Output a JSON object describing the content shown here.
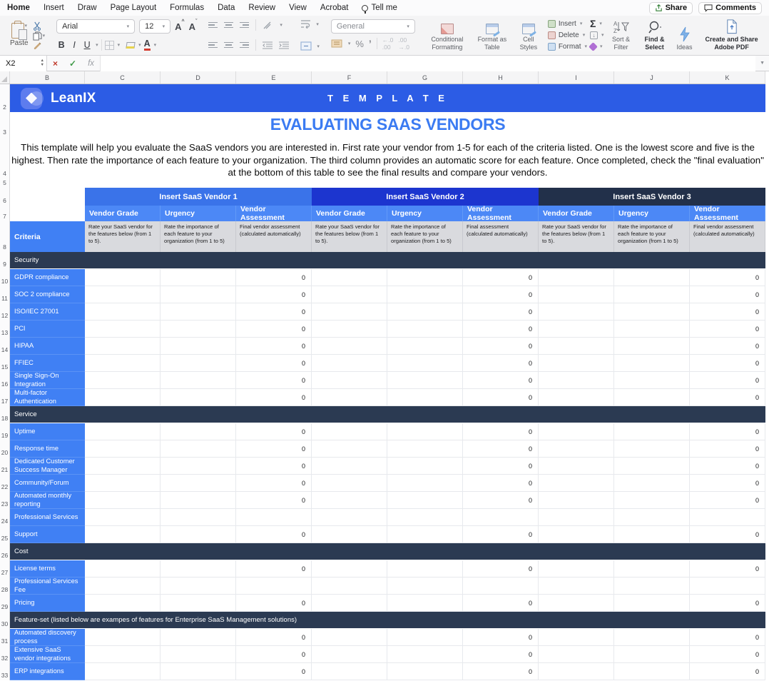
{
  "ribbon": {
    "tabs": [
      {
        "label": "Home",
        "active": true
      },
      {
        "label": "Insert",
        "active": false
      },
      {
        "label": "Draw",
        "active": false
      },
      {
        "label": "Page Layout",
        "active": false
      },
      {
        "label": "Formulas",
        "active": false
      },
      {
        "label": "Data",
        "active": false
      },
      {
        "label": "Review",
        "active": false
      },
      {
        "label": "View",
        "active": false
      },
      {
        "label": "Acrobat",
        "active": false
      },
      {
        "label": "Tell me",
        "active": false
      }
    ],
    "share_label": "Share",
    "comments_label": "Comments",
    "clipboard": {
      "paste": "Paste"
    },
    "font": {
      "name": "Arial",
      "size": "12",
      "bold": "B",
      "italic": "I",
      "underline": "U",
      "grow": "A",
      "shrink": "A",
      "color_letter": "A"
    },
    "number": {
      "format": "General",
      "percent": "%",
      "comma": "’"
    },
    "styles": {
      "conditional": "Conditional Formatting",
      "as_table": "Format as Table",
      "cell_styles": "Cell Styles"
    },
    "cells": {
      "insert": "Insert",
      "delete": "Delete",
      "format": "Format"
    },
    "editing": {
      "sort": "Sort & Filter",
      "find": "Find & Select"
    },
    "ideas_label": "Ideas",
    "adobe_label": "Create and Share Adobe PDF"
  },
  "formula_bar": {
    "name_box": "X2",
    "fx": "fx"
  },
  "sheet": {
    "columns": [
      "B",
      "C",
      "D",
      "E",
      "F",
      "G",
      "H",
      "I",
      "J",
      "K"
    ],
    "gutter_prefix": [
      "2",
      "3",
      "4",
      "5",
      "6",
      "7",
      "8"
    ],
    "banner": {
      "brand": "LeanIX",
      "tag": "T E M P L A T E",
      "color": "#2c5ce5"
    },
    "title": "EVALUATING SAAS VENDORS",
    "title_color": "#3b7bf2",
    "intro": "This template will help you evaluate the SaaS vendors you are interested in. First rate your vendor from 1-5 for each of the criteria listed. One is the lowest score and five is the highest. Then rate the importance of each feature to your organization. The third column provides an automatic score for each feature. Once completed, check the \"final evaluation\" at the bottom of this table to see the final results and compare your vendors.",
    "vendors": [
      {
        "label": "Insert SaaS Vendor 1",
        "color": "#3a73e9"
      },
      {
        "label": "Insert SaaS Vendor 2",
        "color": "#1c35cf"
      },
      {
        "label": "Insert SaaS Vendor 3",
        "color": "#22304a"
      }
    ],
    "subheaders": [
      "Vendor Grade",
      "Urgency",
      "Vendor Assessment"
    ],
    "criteria_header": "Criteria",
    "descriptions": [
      "Rate your SaaS vendor for the features below (from 1 to 5).",
      "Rate the importance of each feature to your organization (from 1 to 5)",
      "Final vendor assessment (calculated automatically)",
      "Rate your SaaS vendor for the features below (from 1 to 5).",
      "Rate the importance of each feature to your organization (from 1 to 5)",
      "Final assessment (calculated automatically)",
      "Rate your SaaS vendor for the features below (from 1 to 5).",
      "Rate the importance of each feature to your organization (from 1 to 5)",
      "Final vendor assessment (calculated automatically)"
    ],
    "zero_value": "0",
    "rows": [
      {
        "n": "9",
        "kind": "section",
        "label": "Security"
      },
      {
        "n": "10",
        "kind": "item",
        "label": "GDPR compliance",
        "zero": true
      },
      {
        "n": "11",
        "kind": "item",
        "label": "SOC 2 compliance",
        "zero": true
      },
      {
        "n": "12",
        "kind": "item",
        "label": "ISO/IEC 27001",
        "zero": true
      },
      {
        "n": "13",
        "kind": "item",
        "label": "PCI",
        "zero": true
      },
      {
        "n": "14",
        "kind": "item",
        "label": "HIPAA",
        "zero": true
      },
      {
        "n": "15",
        "kind": "item",
        "label": "FFIEC",
        "zero": true
      },
      {
        "n": "16",
        "kind": "item",
        "label": "Single Sign-On Integration",
        "zero": true
      },
      {
        "n": "17",
        "kind": "item",
        "label": "Multi-factor Authentication",
        "zero": true
      },
      {
        "n": "18",
        "kind": "section",
        "label": "Service"
      },
      {
        "n": "19",
        "kind": "item",
        "label": "Uptime",
        "zero": true
      },
      {
        "n": "20",
        "kind": "item",
        "label": "Response time",
        "zero": true
      },
      {
        "n": "21",
        "kind": "item",
        "label": "Dedicated Customer Success Manager",
        "zero": true
      },
      {
        "n": "22",
        "kind": "item",
        "label": "Community/Forum",
        "zero": true
      },
      {
        "n": "23",
        "kind": "item",
        "label": "Automated monthly reporting",
        "zero": true
      },
      {
        "n": "24",
        "kind": "item",
        "label": "Professional Services",
        "zero": false
      },
      {
        "n": "25",
        "kind": "item",
        "label": "Support",
        "zero": true
      },
      {
        "n": "26",
        "kind": "section",
        "label": "Cost"
      },
      {
        "n": "27",
        "kind": "item",
        "label": "License terms",
        "zero": true
      },
      {
        "n": "28",
        "kind": "item",
        "label": "Professional Services Fee",
        "zero": false
      },
      {
        "n": "29",
        "kind": "item",
        "label": "Pricing",
        "zero": true
      },
      {
        "n": "30",
        "kind": "section",
        "label": "Feature-set (listed below are exampes of features for Enterprise SaaS Management solutions)"
      },
      {
        "n": "31",
        "kind": "item",
        "label": "Automated discovery process",
        "zero": true
      },
      {
        "n": "32",
        "kind": "item",
        "label": "Extensive SaaS vendor integrations",
        "zero": true
      },
      {
        "n": "33",
        "kind": "item",
        "label": "ERP integrations",
        "zero": true
      }
    ]
  }
}
